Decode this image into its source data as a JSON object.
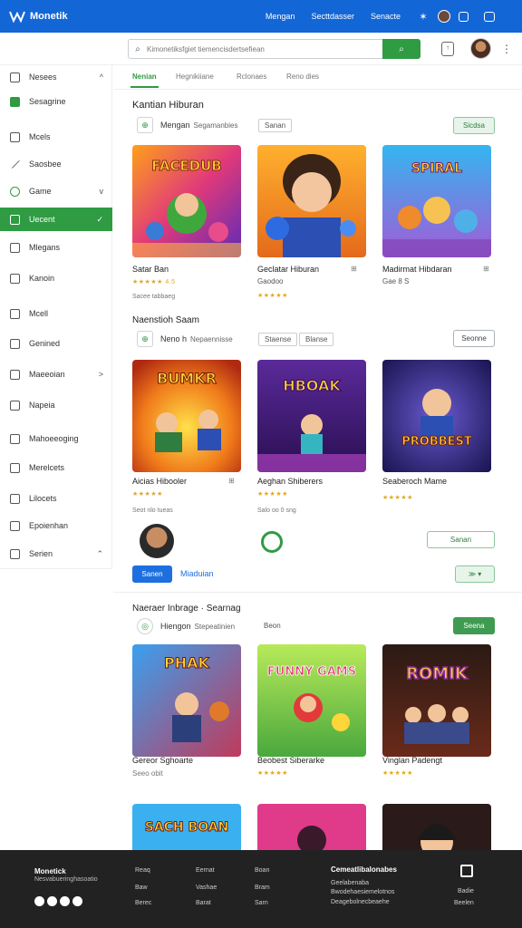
{
  "app": {
    "logo_text": "Monetik",
    "nav": [
      "Mengan",
      "Secttdasser",
      "Senacte"
    ],
    "colors": {
      "brand": "#1366d6",
      "accent": "#2f9b43",
      "footer": "#222222",
      "stars": "#e2a91a"
    }
  },
  "search": {
    "placeholder": "Kimonetiksfgiet tiemencisdertsefiean",
    "button_icon": "search-icon"
  },
  "sidebar": {
    "items": [
      {
        "label": "Nesees",
        "icon": "box-icon",
        "chevron": "^"
      },
      {
        "label": "Sesagrine",
        "icon": "green-square-icon",
        "chevron": ""
      },
      {
        "label": "Mcels",
        "icon": "box-icon",
        "chevron": ""
      },
      {
        "label": "Saosbee",
        "icon": "pencil-icon",
        "chevron": ""
      },
      {
        "label": "Game",
        "icon": "game-icon",
        "chevron": "v"
      },
      {
        "label": "Uecent",
        "icon": "box-icon",
        "chevron": "✓"
      },
      {
        "label": "Mlegans",
        "icon": "list-icon",
        "chevron": ""
      },
      {
        "label": "Kanoin",
        "icon": "minus-box-icon",
        "chevron": ""
      },
      {
        "label": "Mcell",
        "icon": "box-icon",
        "chevron": ""
      },
      {
        "label": "Genined",
        "icon": "box-icon",
        "chevron": ""
      },
      {
        "label": "Maeeoian",
        "icon": "grid-icon",
        "chevron": ">"
      },
      {
        "label": "Napeia",
        "icon": "list-icon",
        "chevron": ""
      },
      {
        "label": "Mahoeeoging",
        "icon": "grid-icon",
        "chevron": ""
      },
      {
        "label": "Merelcets",
        "icon": "box-icon",
        "chevron": ""
      },
      {
        "label": "Lilocets",
        "icon": "box-icon",
        "chevron": ""
      },
      {
        "label": "Epoienhan",
        "icon": "grid-icon",
        "chevron": ""
      },
      {
        "label": "Serien",
        "icon": "box-icon",
        "chevron": "⌃"
      }
    ]
  },
  "tabs": [
    "Nenian",
    "Hegnikiiane",
    "Rclonaes",
    "Reno dies"
  ],
  "section1": {
    "title": "Kantian Hiburan",
    "sub_label": "Mengan",
    "sub_light": "Segamanbies",
    "chip": "Sanan",
    "button": "Sicdsa",
    "games": [
      {
        "title": "Satar Ban",
        "line2": "",
        "stars": "★★★★★ 4.5",
        "meta": "Sacee tabbaeg"
      },
      {
        "title": "Geclatar Hiburan",
        "line2": "Gaodoo",
        "stars": "★★★★★",
        "meta": ""
      },
      {
        "title": "Madirmat Hibdaran",
        "line2": "Gae 8 S",
        "stars": "",
        "meta": ""
      }
    ]
  },
  "section2": {
    "title": "Naenstioh Saam",
    "sub_label": "Neno h",
    "sub_light": "Nepaennisse",
    "chips": [
      "Staense",
      "Blanse"
    ],
    "button": "Seonne",
    "games": [
      {
        "title": "Aicias Hibooler",
        "stars": "★★★★★",
        "meta": "Seot nlo tueas"
      },
      {
        "title": "Aeghan Shiberers",
        "stars": "★★★★★",
        "meta": "Salo oo 0 sng"
      },
      {
        "title": "Seaberoch Mame",
        "stars": "★★★★★",
        "meta": ""
      }
    ],
    "action_blue": "Sanen",
    "action_link": "Miaduian",
    "action_out": "Sanan",
    "action_green": "≫ ▾"
  },
  "section3": {
    "title": "Naeraer Inbrage · Searnag",
    "sub_label": "Hiengon",
    "sub_light": "Stepeatinien",
    "chip": "Beon",
    "button": "Seena",
    "games": [
      {
        "title": "Gereor Sghoarte",
        "stars": "",
        "meta": "Seeo obit"
      },
      {
        "title": "Beobest Siberarke",
        "stars": "★★★★★",
        "meta": ""
      },
      {
        "title": "Vinglan Padengt",
        "stars": "★★★★★",
        "meta": ""
      }
    ]
  },
  "cover_text": [
    "FACEDUB",
    "SPIRAL",
    "BUMKR",
    "HBOAK",
    "PROBBEST",
    "PHAK",
    "FUNNY GAMS",
    "ROMIK",
    "SACH BOAN"
  ],
  "footer": {
    "brand": "Monetick",
    "brand_sub": "Nesvabueringhasoatio",
    "cols": [
      {
        "items": [
          "Reaq",
          "Baw",
          "Berec"
        ]
      },
      {
        "items": [
          "Eernat",
          "Vashae",
          "Barat"
        ]
      },
      {
        "items": [
          "Boan",
          "Bram",
          "Sarn"
        ]
      }
    ],
    "contact_title": "Cemeatlibalonabes",
    "contact_lines": [
      "Geelabenaba",
      "Bwodehaesiemelotnos",
      "Deagebolnecbeaehe"
    ],
    "qr_lines": [
      "Badie",
      "Beelen"
    ]
  }
}
